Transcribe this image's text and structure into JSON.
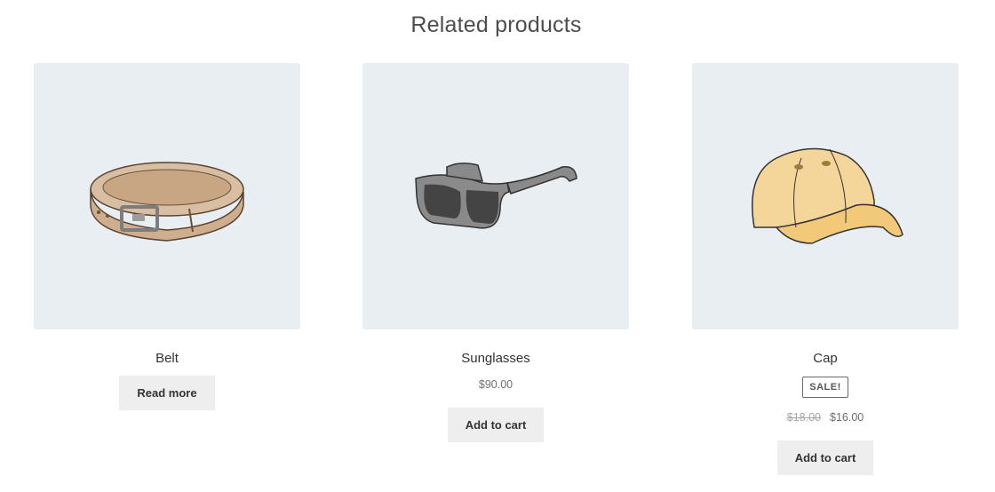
{
  "section": {
    "title": "Related products"
  },
  "products": [
    {
      "name": "Belt",
      "button": "Read more",
      "image": "belt-image"
    },
    {
      "name": "Sunglasses",
      "price": "$90.00",
      "button": "Add to cart",
      "image": "sunglasses-image"
    },
    {
      "name": "Cap",
      "badge": "SALE!",
      "regular_price": "$18.00",
      "sale_price": "$16.00",
      "button": "Add to cart",
      "image": "cap-image"
    }
  ],
  "colors": {
    "thumb_bg": "#e9eef3",
    "button_bg": "#eeeeee",
    "text": "#333333"
  }
}
